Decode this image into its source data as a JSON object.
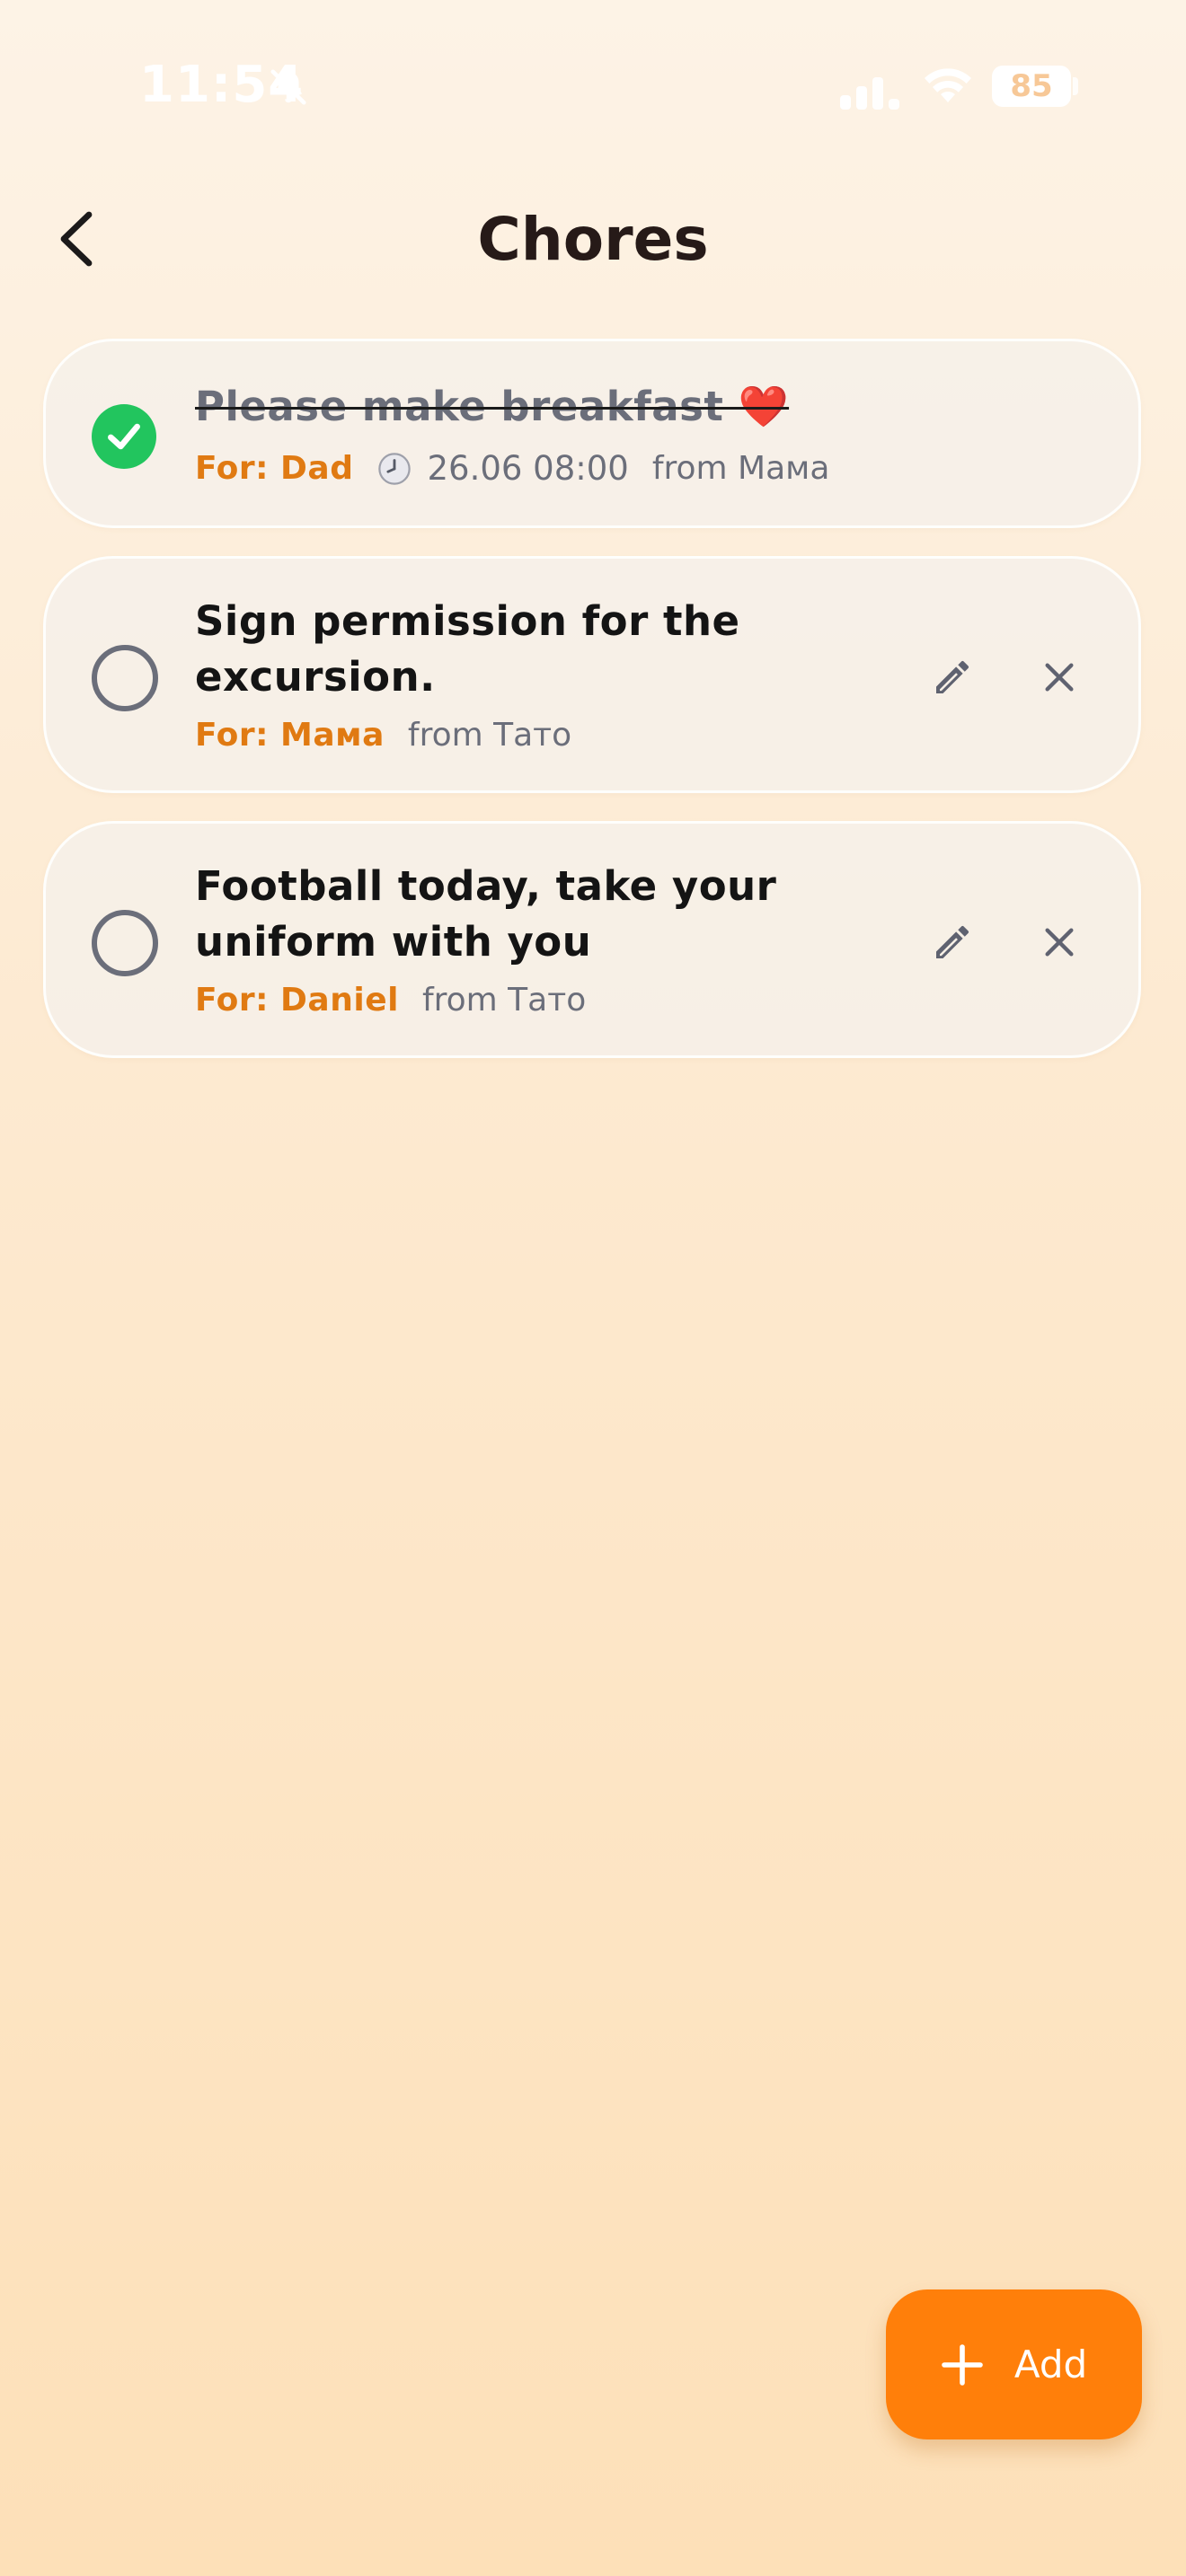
{
  "status_bar": {
    "time": "11:54",
    "battery": "85"
  },
  "header": {
    "title": "Chores"
  },
  "chores": [
    {
      "title": "Please make breakfast ❤️",
      "done": true,
      "for": "For: Dad",
      "due": "26.06 08:00",
      "from": "from Мама"
    },
    {
      "title": "Sign permission for the excursion.",
      "done": false,
      "for": "For: Мама",
      "from": "from Тато"
    },
    {
      "title": "Football today, take your uniform with you",
      "done": false,
      "for": "For: Daniel",
      "from": "from Тато"
    }
  ],
  "fab": {
    "label": "Add"
  },
  "colors": {
    "accent": "#ff7f0a",
    "for_label": "#e07a12",
    "done_check": "#22c55e",
    "muted": "#6b6e7a"
  },
  "icons": {
    "back": "chevron-left-icon",
    "edit": "pencil-icon",
    "delete": "close-icon",
    "clock": "clock-icon",
    "add": "plus-icon"
  }
}
